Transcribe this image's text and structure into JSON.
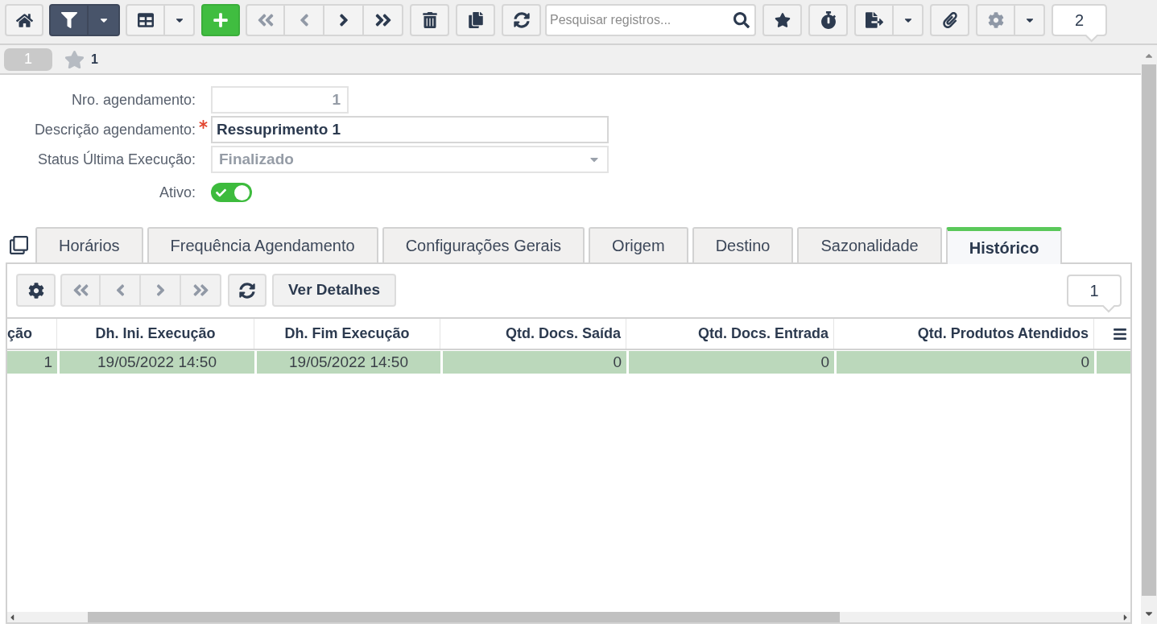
{
  "toolbar": {
    "filter_active": true,
    "navigation": [
      {
        "disabled": true
      },
      {
        "disabled": true
      },
      {
        "disabled": false
      },
      {
        "disabled": false
      }
    ],
    "search": {
      "placeholder": "Pesquisar registros..."
    },
    "record_count": "2"
  },
  "record_bar": {
    "record_tab": "1",
    "favorites_count": "1"
  },
  "form": {
    "fields": [
      {
        "kind": "number",
        "label": "Nro. agendamento:",
        "value": "1",
        "required": false,
        "disabled": true
      },
      {
        "kind": "text",
        "label": "Descrição agendamento:",
        "value": "Ressuprimento 1",
        "required": true,
        "disabled": false
      },
      {
        "kind": "select",
        "label": "Status Última Execução:",
        "value": "Finalizado",
        "required": false,
        "disabled": true
      },
      {
        "kind": "toggle",
        "label": "Ativo:",
        "on": true,
        "required": false,
        "disabled": false
      }
    ]
  },
  "tabs": [
    {
      "label": "Horários",
      "selected": false
    },
    {
      "label": "Frequência Agendamento",
      "selected": false
    },
    {
      "label": "Configurações Gerais",
      "selected": false
    },
    {
      "label": "Origem",
      "selected": false
    },
    {
      "label": "Destino",
      "selected": false
    },
    {
      "label": "Sazonalidade",
      "selected": false
    },
    {
      "label": "Histórico",
      "selected": true
    }
  ],
  "history": {
    "toolbar": {
      "navigation": [
        {
          "disabled": true
        },
        {
          "disabled": true
        },
        {
          "disabled": true
        },
        {
          "disabled": true
        }
      ],
      "details_button": "Ver Detalhes",
      "record_count": "1"
    },
    "table": {
      "columns": [
        {
          "label": "ção",
          "kind": "clipped"
        },
        {
          "label": "Dh. Ini. Execução",
          "kind": "datetime"
        },
        {
          "label": "Dh. Fim Execução",
          "kind": "datetime"
        },
        {
          "label": "Qtd. Docs. Saída",
          "kind": "number"
        },
        {
          "label": "Qtd. Docs. Entrada",
          "kind": "number"
        },
        {
          "label": "Qtd. Produtos Atendidos",
          "kind": "number"
        }
      ],
      "rows": [
        {
          "selected": true,
          "cells": [
            "1",
            "19/05/2022 14:50",
            "19/05/2022 14:50",
            "0",
            "0",
            "0"
          ]
        }
      ]
    }
  }
}
